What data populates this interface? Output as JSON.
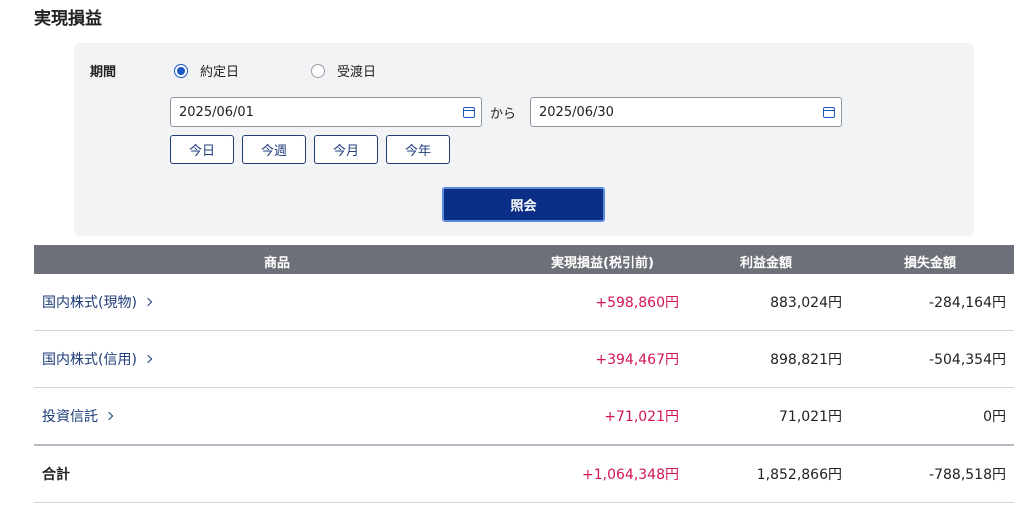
{
  "page": {
    "title": "実現損益"
  },
  "filter": {
    "period_label": "期間",
    "radio_options": [
      {
        "label": "約定日",
        "checked": true
      },
      {
        "label": "受渡日",
        "checked": false
      }
    ],
    "from_date": "2025/06/01",
    "to_label": "から",
    "to_date": "2025/06/30",
    "quick_buttons": [
      "今日",
      "今週",
      "今月",
      "今年"
    ],
    "search_label": "照会"
  },
  "table": {
    "headers": {
      "product": "商品",
      "realized_pl": "実現損益(税引前)",
      "profit": "利益金額",
      "loss": "損失金額"
    },
    "rows": [
      {
        "product": "国内株式(現物)",
        "realized_pl": "+598,860円",
        "profit": "883,024円",
        "loss": "-284,164円"
      },
      {
        "product": "国内株式(信用)",
        "realized_pl": "+394,467円",
        "profit": "898,821円",
        "loss": "-504,354円"
      },
      {
        "product": "投資信託",
        "realized_pl": "+71,021円",
        "profit": "71,021円",
        "loss": "0円"
      }
    ],
    "total": {
      "label": "合計",
      "realized_pl": "+1,064,348円",
      "profit": "1,852,866円",
      "loss": "-788,518円"
    }
  },
  "colors": {
    "accent": "#0b2f86",
    "positive": "#d4145a",
    "header_bg": "#6d7078",
    "panel_bg": "#f2f3f5"
  }
}
